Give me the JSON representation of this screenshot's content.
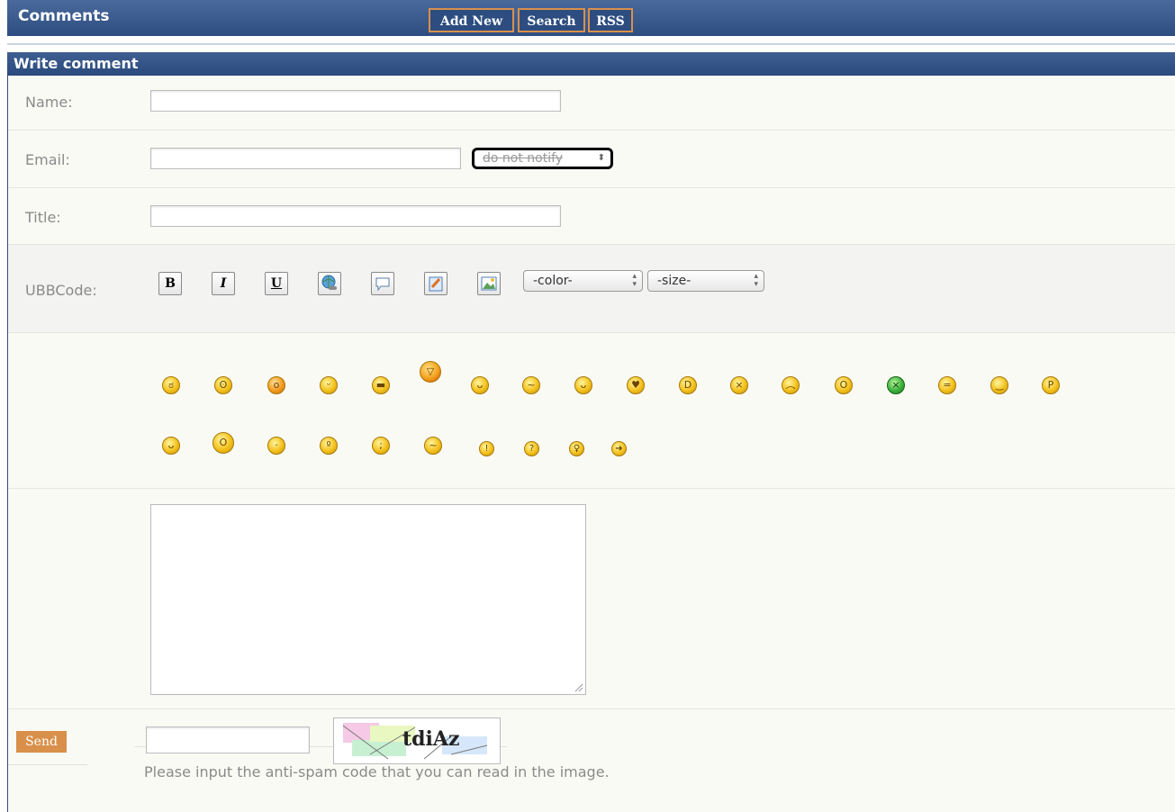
{
  "header": {
    "title": "Comments",
    "buttons": [
      "Add New",
      "Search",
      "RSS"
    ]
  },
  "form": {
    "section_title": "Write comment",
    "name_label": "Name:",
    "email_label": "Email:",
    "notify_option": "do not notify",
    "title_label": "Title:",
    "ubb_label": "UBBCode:",
    "ubb_buttons": {
      "bold": "B",
      "italic": "I",
      "underline": "U"
    },
    "color_option": "-color-",
    "size_option": "-size-",
    "send_label": "Send",
    "captcha_text": "tdiAz",
    "hint": "Please input the anti-spam code that you can read in the image."
  }
}
